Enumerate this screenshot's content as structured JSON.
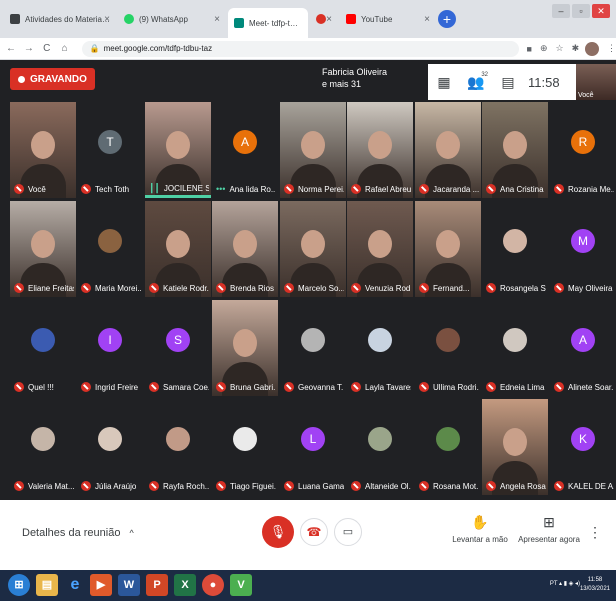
{
  "browser": {
    "tabs": [
      {
        "title": "Atividades do Material 1 \"C\" CH",
        "favicon_color": "#3c4043",
        "close": "×"
      },
      {
        "title": "(9) WhatsApp",
        "favicon_color": "#25d366",
        "close": "×"
      },
      {
        "title": "Meet- tdfp-tdbu-taz",
        "favicon_color": "#00897b",
        "close": "×"
      },
      {
        "title": "",
        "favicon_color": "#d93025",
        "close": "×"
      },
      {
        "title": "YouTube",
        "favicon_color": "#ff0000",
        "close": "×"
      }
    ],
    "new_tab": "+",
    "url": "meet.google.com/tdfp-tdbu-taz"
  },
  "meeting": {
    "recording_label": "GRAVANDO",
    "presenter_name": "Fabricia Oliveira",
    "presenter_more": "e mais 31",
    "participant_count_badge": "32",
    "clock": "11:58",
    "self_label": "Você"
  },
  "participants": [
    {
      "name": "Você",
      "type": "video",
      "muted": true,
      "color": "#8a6a5c"
    },
    {
      "name": "Tech Toth",
      "type": "avatar",
      "initial": "T",
      "muted": true,
      "color": "#5f6b73"
    },
    {
      "name": "JOCILENE S...",
      "type": "video",
      "muted": false,
      "speaking": true,
      "color": "#b89a8f"
    },
    {
      "name": "Ana lida Ro...",
      "type": "avatar",
      "initial": "A",
      "muted": false,
      "color": "#e8710a"
    },
    {
      "name": "Norma Perei...",
      "type": "video",
      "muted": true,
      "color": "#a8a39b"
    },
    {
      "name": "Rafael Abreu",
      "type": "video",
      "muted": true,
      "color": "#cfc9c1"
    },
    {
      "name": "Jacaranda ...",
      "type": "video",
      "muted": true,
      "color": "#c7b7a5"
    },
    {
      "name": "Ana Cristina ...",
      "type": "video",
      "muted": true,
      "color": "#7f7363"
    },
    {
      "name": "Rozania Me...",
      "type": "avatar",
      "initial": "R",
      "muted": true,
      "color": "#e8710a"
    },
    {
      "name": "Eliane Freitas",
      "type": "video",
      "muted": true,
      "color": "#b6ada6"
    },
    {
      "name": "Maria Morei...",
      "type": "photo",
      "muted": true,
      "color": "#8a6240"
    },
    {
      "name": "Katiele Rodr...",
      "type": "video",
      "muted": true,
      "color": "#5e4a40"
    },
    {
      "name": "Brenda Rios",
      "type": "video",
      "muted": true,
      "color": "#b4a39a"
    },
    {
      "name": "Marcelo So...",
      "type": "video",
      "muted": true,
      "color": "#7b6a5f"
    },
    {
      "name": "Venuzia Rod...",
      "type": "video",
      "muted": true,
      "color": "#6f5a50"
    },
    {
      "name": "Fernand...",
      "type": "video",
      "muted": true,
      "color": "#a88b79"
    },
    {
      "name": "Rosangela S...",
      "type": "photo",
      "muted": true,
      "color": "#d2b5a5"
    },
    {
      "name": "May Oliveira",
      "type": "avatar",
      "initial": "M",
      "muted": true,
      "color": "#a142f4"
    },
    {
      "name": "Quel !!!",
      "type": "photo",
      "muted": true,
      "color": "#3b5bb1"
    },
    {
      "name": "Ingrid Freire",
      "type": "avatar",
      "initial": "I",
      "muted": true,
      "color": "#a142f4"
    },
    {
      "name": "Samara Coe...",
      "type": "avatar",
      "initial": "S",
      "muted": true,
      "color": "#a142f4"
    },
    {
      "name": "Bruna Gabri...",
      "type": "video",
      "muted": true,
      "color": "#c4a99a"
    },
    {
      "name": "Geovanna T...",
      "type": "photo",
      "muted": true,
      "color": "#b4b4b4"
    },
    {
      "name": "Layla Tavares",
      "type": "photo",
      "muted": true,
      "color": "#c8d3e0"
    },
    {
      "name": "Ullima Rodri...",
      "type": "photo",
      "muted": true,
      "color": "#7a5040"
    },
    {
      "name": "Edneia Lima",
      "type": "photo",
      "muted": true,
      "color": "#d0c8c0"
    },
    {
      "name": "Alinete Soar...",
      "type": "avatar",
      "initial": "A",
      "muted": true,
      "color": "#a142f4"
    },
    {
      "name": "Valeria Mat...",
      "type": "photo",
      "muted": true,
      "color": "#c5b5a8"
    },
    {
      "name": "Júlia Araújo",
      "type": "photo",
      "muted": true,
      "color": "#d8c8bb"
    },
    {
      "name": "Rayfa Roch...",
      "type": "photo",
      "muted": true,
      "color": "#c19a87"
    },
    {
      "name": "Tiago Figuei...",
      "type": "photo",
      "muted": true,
      "color": "#eaeaea"
    },
    {
      "name": "Luana Gama",
      "type": "avatar",
      "initial": "L",
      "muted": true,
      "color": "#a142f4"
    },
    {
      "name": "Altaneide Ol...",
      "type": "photo",
      "muted": true,
      "color": "#9aa58a"
    },
    {
      "name": "Rosana Mot...",
      "type": "photo",
      "muted": true,
      "color": "#5c8a4a"
    },
    {
      "name": "Angela Rosa",
      "type": "video",
      "muted": true,
      "color": "#c49a80"
    },
    {
      "name": "KALEL DE A...",
      "type": "avatar",
      "initial": "K",
      "muted": true,
      "color": "#a142f4"
    }
  ],
  "controls": {
    "details_label": "Detalhes da reunião",
    "details_chevron": "^",
    "raise_hand_label": "Levantar a mão",
    "present_label": "Apresentar agora"
  },
  "taskbar": {
    "lang": "PT",
    "time": "11:58",
    "date": "13/03/2021"
  }
}
